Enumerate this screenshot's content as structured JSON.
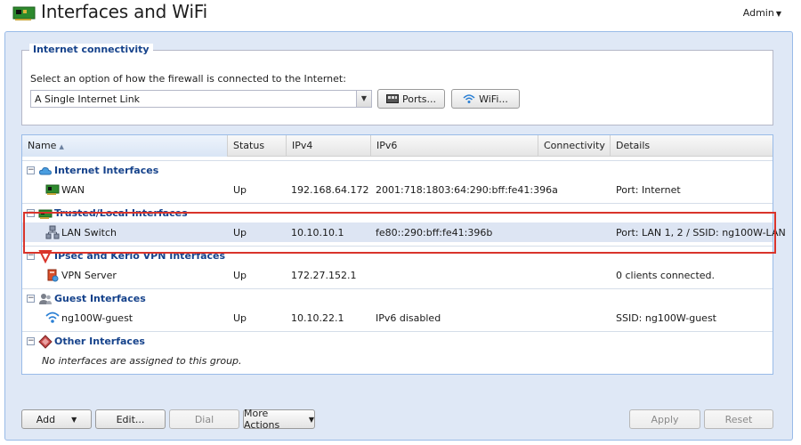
{
  "header": {
    "title": "Interfaces and WiFi",
    "user_menu": "Admin"
  },
  "connectivity": {
    "legend": "Internet connectivity",
    "prompt": "Select an option of how the firewall is connected to the Internet:",
    "mode_value": "A Single Internet Link",
    "ports_button": "Ports...",
    "wifi_button": "WiFi..."
  },
  "grid": {
    "columns": [
      "Name",
      "Status",
      "IPv4",
      "IPv6",
      "Connectivity",
      "Details"
    ],
    "groups": [
      {
        "label": "Internet Interfaces",
        "icon": "cloud-icon",
        "rows": [
          {
            "name": "WAN",
            "icon": "network-card-icon",
            "status": "Up",
            "ipv4": "192.168.64.172",
            "ipv6": "2001:718:1803:64:290:bff:fe41:396a",
            "connectivity": "",
            "details": "Port: Internet"
          }
        ]
      },
      {
        "label": "Trusted/Local Interfaces",
        "icon": "network-card-icon",
        "rows": [
          {
            "name": "LAN Switch",
            "icon": "switch-icon",
            "status": "Up",
            "ipv4": "10.10.10.1",
            "ipv6": "fe80::290:bff:fe41:396b",
            "connectivity": "",
            "details": "Port: LAN 1, 2 / SSID: ng100W-LAN",
            "selected": true
          }
        ]
      },
      {
        "label": "IPsec and Kerio VPN Interfaces",
        "icon": "shield-icon",
        "rows": [
          {
            "name": "VPN Server",
            "icon": "vpn-server-icon",
            "status": "Up",
            "ipv4": "172.27.152.1",
            "ipv6": "",
            "connectivity": "",
            "details": "0 clients connected."
          }
        ]
      },
      {
        "label": "Guest Interfaces",
        "icon": "users-icon",
        "rows": [
          {
            "name": "ng100W-guest",
            "icon": "wifi-icon",
            "status": "Up",
            "ipv4": "10.10.22.1",
            "ipv6": "IPv6 disabled",
            "connectivity": "",
            "details": "SSID: ng100W-guest"
          }
        ]
      },
      {
        "label": "Other Interfaces",
        "icon": "diamond-icon",
        "empty_text": "No interfaces are assigned to this group."
      }
    ]
  },
  "toolbar": {
    "add": "Add",
    "edit": "Edit...",
    "dial": "Dial",
    "more_actions": "More Actions",
    "apply": "Apply",
    "reset": "Reset"
  },
  "colors": {
    "accent": "#15428b",
    "panel_bg": "#dfe8f6",
    "highlight": "#d9342b",
    "selected_row": "#dde5f3"
  }
}
